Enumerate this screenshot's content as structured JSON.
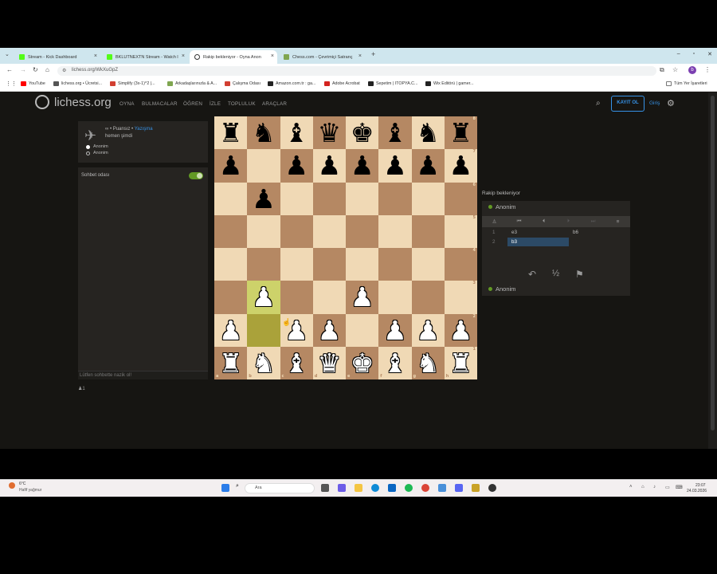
{
  "browser": {
    "tabs": [
      {
        "title": "Stream - Kick Dashboard",
        "color": "#53fc18"
      },
      {
        "title": "BKLUTNEXTN Stream - Watch l",
        "color": "#53fc18"
      },
      {
        "title": "Rakip bekleniyor - Oyna Anon",
        "color": "#ffffff",
        "active": true
      },
      {
        "title": "Chess.com - Çevrimiçi Satranç",
        "color": "#7fa650"
      }
    ],
    "new_tab": "+",
    "url": "lichess.org/WkXuGpZ",
    "bookmarks": [
      {
        "label": "YouTube",
        "color": "#ff0000"
      },
      {
        "label": "lichess.org • Ücretsi...",
        "color": "#555555"
      },
      {
        "label": "Simplify (3x-1)^2 |...",
        "color": "#d23f31"
      },
      {
        "label": "Arkadaşlarınızla & A...",
        "color": "#7fa650"
      },
      {
        "label": "Çalışma Odası",
        "color": "#d23f31"
      },
      {
        "label": "Amazon.com.tr : ga...",
        "color": "#222222"
      },
      {
        "label": "Adobe Acrobat",
        "color": "#d4231f"
      },
      {
        "label": "Sepetim | ITOPYA.C...",
        "color": "#222222"
      },
      {
        "label": "Wix Editörü | gamer...",
        "color": "#222222"
      }
    ],
    "all_bookmarks": "Tüm Yer İşaretleri"
  },
  "site": {
    "logo": "lichess.org",
    "nav": [
      "OYNA",
      "BULMACALAR",
      "ÖĞREN",
      "İZLE",
      "TOPLULUK",
      "ARAÇLAR"
    ],
    "signup": "KAYIT OL",
    "login": "Giriş"
  },
  "game_info": {
    "line1_prefix": "∞ • Puansız • ",
    "line1_link": "Yazışma",
    "line2": "hemen şimdi",
    "players": [
      "Anonim",
      "Anonim"
    ]
  },
  "chat": {
    "title": "Sohbet odası",
    "placeholder": "Lütfen sohbette nazik ol!",
    "spectators": "♟1"
  },
  "board": {
    "ranks": [
      [
        "br",
        "bn",
        "bb",
        "bq",
        "bk",
        "bb",
        "bn",
        "br"
      ],
      [
        "bp",
        "",
        "bp",
        "bp",
        "bp",
        "bp",
        "bp",
        "bp"
      ],
      [
        "",
        "bp",
        "",
        "",
        "",
        "",
        "",
        ""
      ],
      [
        "",
        "",
        "",
        "",
        "",
        "",
        "",
        ""
      ],
      [
        "",
        "",
        "",
        "",
        "",
        "",
        "",
        ""
      ],
      [
        "",
        "wp",
        "",
        "",
        "wp",
        "",
        "",
        ""
      ],
      [
        "wp",
        "",
        "wp",
        "wp",
        "",
        "wp",
        "wp",
        "wp"
      ],
      [
        "wr",
        "wn",
        "wb",
        "wq",
        "wk",
        "wb",
        "wn",
        "wr"
      ]
    ],
    "highlights": [
      "b3",
      "b2"
    ],
    "rank_labels": [
      "8",
      "7",
      "6",
      "5",
      "4",
      "3",
      "2",
      "1"
    ],
    "file_labels": [
      "a",
      "b",
      "c",
      "d",
      "e",
      "f",
      "g",
      "h"
    ]
  },
  "right_panel": {
    "status": "Rakip bekleniyor",
    "top_player": "Anonim",
    "bottom_player": "Anonim",
    "moves": [
      {
        "num": "1",
        "white": "e3",
        "black": "b6"
      },
      {
        "num": "2",
        "white": "b3",
        "black": ""
      }
    ],
    "draw_label": "½"
  },
  "taskbar": {
    "temp": "6°C",
    "weather": "Hafif yağmur",
    "search": "Ara",
    "time": "23:07",
    "date": "24.03.2026"
  }
}
